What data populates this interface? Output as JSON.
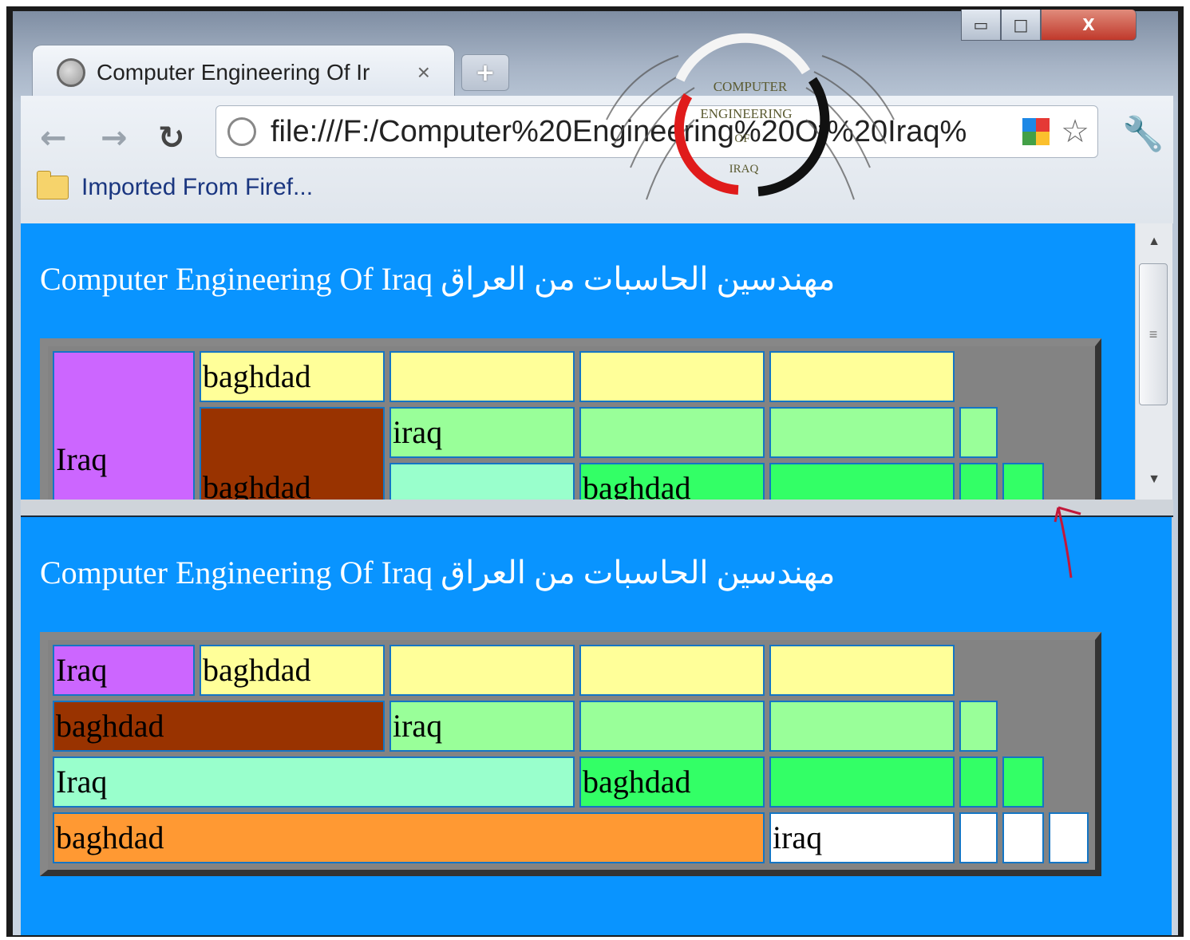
{
  "browser": {
    "tab_title": "Computer Engineering Of Ir",
    "tab_close": "×",
    "new_tab": "+",
    "address": "file:///F:/Computer%20Engineering%20Of%20Iraq%",
    "bookmark": "Imported From Firef...",
    "window_controls": {
      "minimize": "▭",
      "maximize": "□",
      "close": "X"
    }
  },
  "logo": {
    "line1": "COMPUTER",
    "line2": "ENGINEERING",
    "line3": "OF",
    "line4": "IRAQ"
  },
  "page": {
    "title": "Computer Engineering Of Iraq مهندسين الحاسبات من العراق"
  },
  "top_table": {
    "cells": [
      "baghdad",
      "iraq",
      "Iraq",
      "baghdad",
      "baghdad"
    ]
  },
  "bottom_table": {
    "cells": [
      "Iraq",
      "baghdad",
      "baghdad",
      "iraq",
      "Iraq",
      "baghdad",
      "baghdad",
      "iraq"
    ]
  },
  "colors": {
    "page_bg": "#0994ff",
    "purple": "#cc66ff",
    "yellow": "#ffff99",
    "brown": "#993300",
    "light_green": "#99ff99",
    "aqua": "#99ffcc",
    "green": "#33ff66",
    "orange": "#ff9933",
    "white": "#ffffff"
  },
  "icons": [
    "globe-icon",
    "back-arrow-icon",
    "forward-arrow-icon",
    "reload-icon",
    "star-icon",
    "wrench-icon",
    "folder-icon"
  ]
}
